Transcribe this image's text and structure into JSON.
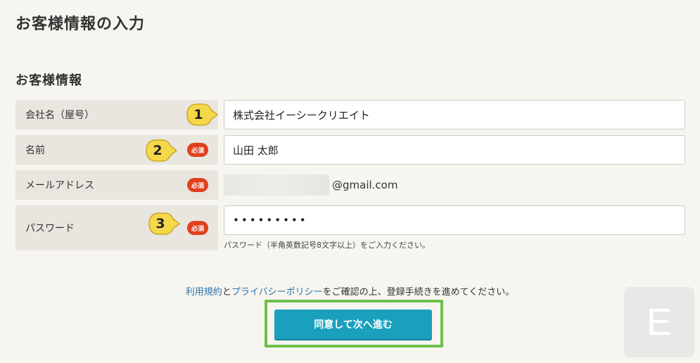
{
  "page": {
    "title": "お客様情報の入力"
  },
  "section": {
    "title": "お客様情報"
  },
  "form": {
    "company": {
      "label": "会社名（屋号）",
      "value": "株式会社イーシークリエイト"
    },
    "name": {
      "label": "名前",
      "required": "必須",
      "value": "山田 太郎"
    },
    "email": {
      "label": "メールアドレス",
      "required": "必須",
      "domain": "@gmail.com"
    },
    "password": {
      "label": "パスワード",
      "required": "必須",
      "value": "•••••••••",
      "hint": "パスワード（半角英数記号8文字以上）をご入力ください。"
    }
  },
  "callouts": [
    "1",
    "2",
    "3"
  ],
  "agreement": {
    "terms_link": "利用規約",
    "and": "と",
    "privacy_link": "プライバシーポリシー",
    "rest": "をご確認の上、登録手続きを進めてください。"
  },
  "submit": {
    "label": "同意して次へ進む"
  },
  "logo": {
    "letter": "E"
  },
  "colors": {
    "accent": "#1aa0bd",
    "required_badge": "#e0401e",
    "highlight": "#6cc04a",
    "callout": "#f5d84a",
    "link": "#2a73a8"
  }
}
